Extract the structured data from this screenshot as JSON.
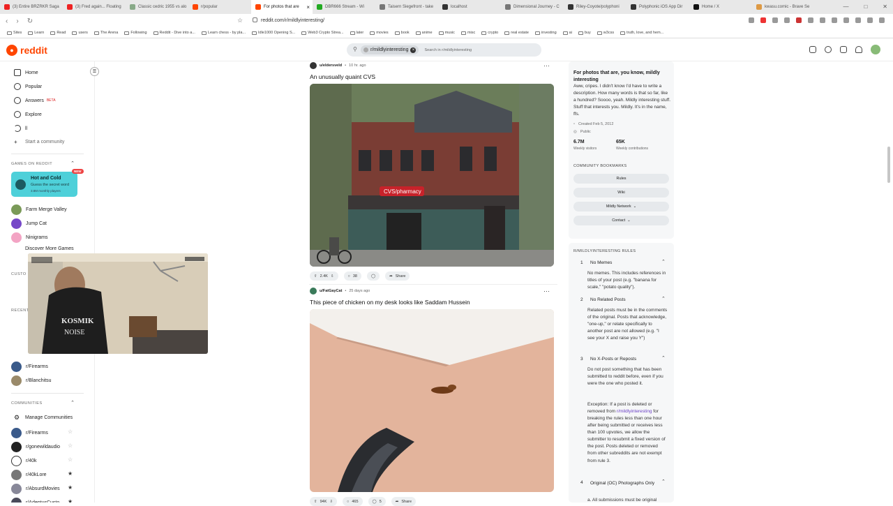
{
  "browser": {
    "tabs": [
      {
        "label": "(3) Entire BRZRKR Saga",
        "color": "#e22"
      },
      {
        "label": "(3) Fred again... Floating",
        "color": "#e22"
      },
      {
        "label": "Classic cedric 1955 vs alo",
        "color": "#8a8"
      },
      {
        "label": "r/popular",
        "color": "#ff4500"
      },
      {
        "label": "For photos that are",
        "color": "#ff4500",
        "active": true
      },
      {
        "label": "DBR666 Stream - Wi",
        "color": "#2a2"
      },
      {
        "label": "Taisern Siegefront - take",
        "color": "#777"
      },
      {
        "label": "localhost",
        "color": "#333"
      },
      {
        "label": "Dimensional Journey - C",
        "color": "#777"
      },
      {
        "label": "Riley-Coyote/polyphoni",
        "color": "#333"
      },
      {
        "label": "Polyphonic iOS App Dir",
        "color": "#333"
      },
      {
        "label": "Home / X",
        "color": "#111"
      },
      {
        "label": "kwasu.comic - Brave Se",
        "color": "#d94"
      }
    ],
    "url": "reddit.com/r/mildlyinteresting/",
    "bookmarks": [
      "Sites",
      "Learn",
      "Read",
      "users",
      "The Arena",
      "Following",
      "Reddit - Dive into a...",
      "Learn chess - by pla...",
      "Idle1000 Opening S...",
      "Web3 Crypto Strea...",
      "later",
      "movies",
      "book",
      "anime",
      "music",
      "misc",
      "crypto",
      "real estate",
      "investing",
      "ai",
      "buy",
      "w3css",
      "truth, love, and hem..."
    ]
  },
  "header": {
    "logo": "reddit",
    "search_chip": "r/mildlyinteresting",
    "search_placeholder": "Search in r/mildlyinteresting"
  },
  "sidebar": {
    "nav": [
      {
        "label": "Home"
      },
      {
        "label": "Popular"
      },
      {
        "label": "Answers",
        "badge": "BETA"
      },
      {
        "label": "Explore"
      },
      {
        "label": "ll"
      },
      {
        "label": "Start a community"
      }
    ],
    "games_header": "GAMES ON REDDIT",
    "game_card": {
      "title": "Hot and Cold",
      "subtitle": "Guess the secret word",
      "players": "3.8M monthly players",
      "badge": "NEW"
    },
    "games": [
      "Farm Merge Valley",
      "Jump Cat",
      "Ninigrams",
      "Discover More Games"
    ],
    "custom_header": "CUSTO",
    "recent_header": "RECENT",
    "recent": [
      "r/Firearms",
      "r/Blanchitsu"
    ],
    "communities_header": "COMMUNITIES",
    "manage": "Manage Communities",
    "communities": [
      "r/Firearms",
      "r/gonewildaudio",
      "r/40k",
      "r/40kLore",
      "r/AbsurdMovies",
      "r/AdeptusCusto"
    ]
  },
  "posts": [
    {
      "user": "u/eldersveld",
      "time": "10 hr. ago",
      "title": "An unusually quaint CVS",
      "votes": "2.4K",
      "comments": "38",
      "share": "Share"
    },
    {
      "user": "u/FatGayCat",
      "time": "25 days ago",
      "title": "This piece of chicken on my desk looks like Saddam Hussein",
      "votes": "94K",
      "comments": "465",
      "awards": "5",
      "share": "Share"
    }
  ],
  "about": {
    "title": "For photos that are, you know, mildly interesting",
    "description": "Aww, cripes. I didn't know I'd have to write a description. How many words is that so far, like a hundred? Soooo, yeah. Mildly interesting stuff. Stuff that interests you. Mildly. It's in the name, ffs.",
    "created": "Created Feb 5, 2012",
    "visibility": "Public",
    "visitors": "6.7M",
    "visitors_label": "Weekly visitors",
    "contrib": "65K",
    "contrib_label": "Weekly contributions",
    "bookmarks_header": "COMMUNITY BOOKMARKS",
    "bookmarks": [
      "Rules",
      "Wiki",
      "Mildly Network",
      "Contact"
    ]
  },
  "rules": {
    "header": "R/MILDLYINTERESTING RULES",
    "items": [
      {
        "n": "1",
        "name": "No Memes",
        "text": "No memes. This includes references in titles of your post (e.g. \"banana for scale,\" \"potato quality\")."
      },
      {
        "n": "2",
        "name": "No Related Posts",
        "text": "Related posts must be in the comments of the original. Posts that acknowledge, \"one-up,\" or relate specifically to another post are not allowed (e.g. \"I see your X and raise you Y\")"
      },
      {
        "n": "3",
        "name": "No X-Posts or Reposts",
        "text": "Do not post something that has been submitted to reddit before, even if you were the one who posted it."
      },
      {
        "n": "4",
        "name": "Original (OC) Photographs Only",
        "text": "a. All submissions must be original"
      }
    ],
    "rule3_ex_pre": "Exception: If a post is deleted or removed from ",
    "rule3_ex_link": "r/mildlyinteresting",
    "rule3_ex_post": " for breaking the rules less than one hour after being submitted or receives less than 100 upvotes, we allow the submitter to resubmit a fixed version of the post. Posts deleted or removed from other subreddits are not exempt from rule 3."
  },
  "cam_overlay": {
    "shirt_text1": "KOSMIK",
    "shirt_text2": "NOISE"
  }
}
